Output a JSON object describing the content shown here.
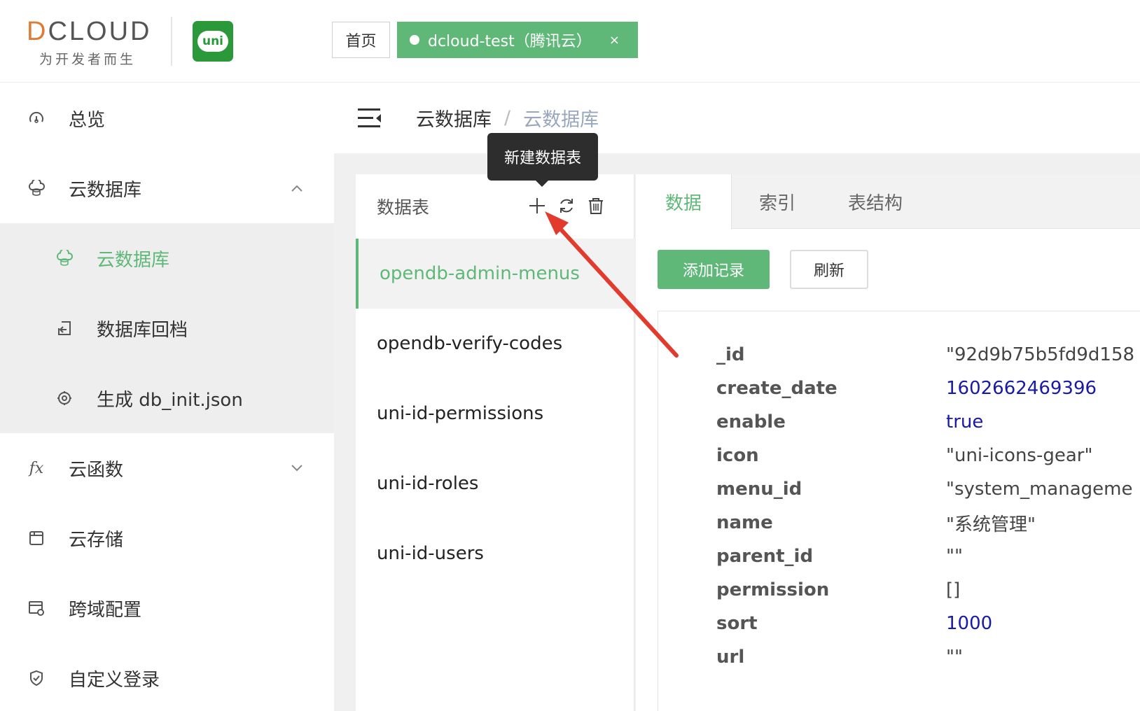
{
  "header": {
    "logo_text": "DCLOUD",
    "logo_slogan": "为开发者而生",
    "uni_logo_text": "uni",
    "tabs": [
      {
        "label": "首页"
      },
      {
        "label": "dcloud-test（腾讯云）",
        "close": "×"
      }
    ]
  },
  "sidebar": {
    "items": [
      {
        "label": "总览",
        "icon": "dashboard-icon"
      },
      {
        "label": "云数据库",
        "icon": "cloud-database-icon",
        "expanded": true
      },
      {
        "label": "云函数",
        "icon": "fx-icon",
        "icon_text": "fx"
      },
      {
        "label": "云存储",
        "icon": "storage-icon"
      },
      {
        "label": "跨域配置",
        "icon": "browser-config-icon"
      },
      {
        "label": "自定义登录",
        "icon": "shield-icon"
      }
    ],
    "sub_items": [
      {
        "label": "云数据库",
        "icon": "cloud-database-icon",
        "active": true
      },
      {
        "label": "数据库回档",
        "icon": "rollback-icon"
      },
      {
        "label": "生成 db_init.json",
        "icon": "generate-icon"
      }
    ]
  },
  "breadcrumb": {
    "first": "云数据库",
    "separator": "/",
    "second": "云数据库"
  },
  "table_panel": {
    "title": "数据表",
    "tooltip": "新建数据表",
    "tables": [
      "opendb-admin-menus",
      "opendb-verify-codes",
      "uni-id-permissions",
      "uni-id-roles",
      "uni-id-users"
    ],
    "selected_index": 0
  },
  "data_panel": {
    "tabs": [
      "数据",
      "索引",
      "表结构"
    ],
    "active_tab": 0,
    "add_button": "添加记录",
    "refresh_button": "刷新",
    "record": [
      {
        "key": "_id",
        "value": "\"92d9b75b5fd9d158"
      },
      {
        "key": "create_date",
        "value": "1602662469396"
      },
      {
        "key": "enable",
        "value": "true"
      },
      {
        "key": "icon",
        "value": "\"uni-icons-gear\""
      },
      {
        "key": "menu_id",
        "value": "\"system_manageme"
      },
      {
        "key": "name",
        "value": "\"系统管理\""
      },
      {
        "key": "parent_id",
        "value": "\"\""
      },
      {
        "key": "permission",
        "value": "[]"
      },
      {
        "key": "sort",
        "value": "1000"
      },
      {
        "key": "url",
        "value": "\"\""
      }
    ]
  },
  "colors": {
    "accent": "#5fb878",
    "brand_green": "#2b9939",
    "annotation_arrow": "#e23b2e",
    "number_value": "#1a1aa6"
  }
}
